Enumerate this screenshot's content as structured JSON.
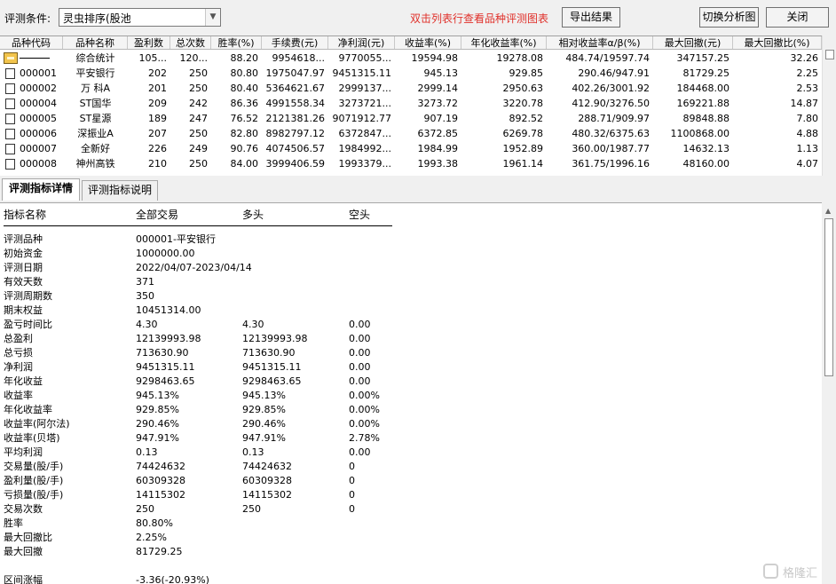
{
  "toolbar": {
    "condition_label": "评测条件:",
    "condition_value": "灵虫排序(股池",
    "hint": "双击列表行查看品种评测图表",
    "export_label": "导出结果",
    "switch_label": "切换分析图",
    "close_label": "关闭"
  },
  "grid": {
    "columns": [
      "品种代码",
      "品种名称",
      "盈利数",
      "总次数",
      "胜率(%)",
      "手续费(元)",
      "净利润(元)",
      "收益率(%)",
      "年化收益率(%)",
      "相对收益率α/β(%)",
      "最大回撤(元)",
      "最大回撤比(%)"
    ],
    "rows": [
      {
        "code": "",
        "name": "综合统计",
        "win": "105...",
        "total": "120...",
        "rate": "88.20",
        "fee": "9954618...",
        "profit": "9770055...",
        "ret": "19594.98",
        "annual": "19278.08",
        "rel": "484.74/19597.74",
        "maxdd": "347157.25",
        "ddratio": "32.26",
        "icon": "folder"
      },
      {
        "code": "000001",
        "name": "平安银行",
        "win": "202",
        "total": "250",
        "rate": "80.80",
        "fee": "1975047.97",
        "profit": "9451315.11",
        "ret": "945.13",
        "annual": "929.85",
        "rel": "290.46/947.91",
        "maxdd": "81729.25",
        "ddratio": "2.25",
        "icon": "doc"
      },
      {
        "code": "000002",
        "name": "万 科A",
        "win": "201",
        "total": "250",
        "rate": "80.40",
        "fee": "5364621.67",
        "profit": "2999137...",
        "ret": "2999.14",
        "annual": "2950.63",
        "rel": "402.26/3001.92",
        "maxdd": "184468.00",
        "ddratio": "2.53",
        "icon": "doc"
      },
      {
        "code": "000004",
        "name": "ST国华",
        "win": "209",
        "total": "242",
        "rate": "86.36",
        "fee": "4991558.34",
        "profit": "3273721...",
        "ret": "3273.72",
        "annual": "3220.78",
        "rel": "412.90/3276.50",
        "maxdd": "169221.88",
        "ddratio": "14.87",
        "icon": "doc"
      },
      {
        "code": "000005",
        "name": "ST星源",
        "win": "189",
        "total": "247",
        "rate": "76.52",
        "fee": "2121381.26",
        "profit": "9071912.77",
        "ret": "907.19",
        "annual": "892.52",
        "rel": "288.71/909.97",
        "maxdd": "89848.88",
        "ddratio": "7.80",
        "icon": "doc"
      },
      {
        "code": "000006",
        "name": "深振业A",
        "win": "207",
        "total": "250",
        "rate": "82.80",
        "fee": "8982797.12",
        "profit": "6372847...",
        "ret": "6372.85",
        "annual": "6269.78",
        "rel": "480.32/6375.63",
        "maxdd": "1100868.00",
        "ddratio": "4.88",
        "icon": "doc"
      },
      {
        "code": "000007",
        "name": "全新好",
        "win": "226",
        "total": "249",
        "rate": "90.76",
        "fee": "4074506.57",
        "profit": "1984992...",
        "ret": "1984.99",
        "annual": "1952.89",
        "rel": "360.00/1987.77",
        "maxdd": "14632.13",
        "ddratio": "1.13",
        "icon": "doc"
      },
      {
        "code": "000008",
        "name": "神州高铁",
        "win": "210",
        "total": "250",
        "rate": "84.00",
        "fee": "3999406.59",
        "profit": "1993379...",
        "ret": "1993.38",
        "annual": "1961.14",
        "rel": "361.75/1996.16",
        "maxdd": "48160.00",
        "ddratio": "4.07",
        "icon": "doc"
      }
    ]
  },
  "tabs": {
    "detail": "评测指标详情",
    "desc": "评测指标说明"
  },
  "detail": {
    "headers": [
      "指标名称",
      "全部交易",
      "多头",
      "空头"
    ],
    "rows": [
      {
        "name": "评测品种",
        "all": "000001-平安银行",
        "long": "",
        "short": ""
      },
      {
        "name": "初始资金",
        "all": "1000000.00",
        "long": "",
        "short": ""
      },
      {
        "name": "评测日期",
        "all": "2022/04/07-2023/04/14",
        "long": "",
        "short": ""
      },
      {
        "name": "有效天数",
        "all": "371",
        "long": "",
        "short": ""
      },
      {
        "name": "评测周期数",
        "all": "350",
        "long": "",
        "short": ""
      },
      {
        "name": "期末权益",
        "all": "10451314.00",
        "long": "",
        "short": ""
      },
      {
        "name": "盈亏时间比",
        "all": "4.30",
        "long": "4.30",
        "short": "0.00"
      },
      {
        "name": "总盈利",
        "all": "12139993.98",
        "long": "12139993.98",
        "short": "0.00"
      },
      {
        "name": "总亏损",
        "all": "713630.90",
        "long": "713630.90",
        "short": "0.00"
      },
      {
        "name": "净利润",
        "all": "9451315.11",
        "long": "9451315.11",
        "short": "0.00"
      },
      {
        "name": "年化收益",
        "all": "9298463.65",
        "long": "9298463.65",
        "short": "0.00"
      },
      {
        "name": "收益率",
        "all": "945.13%",
        "long": "945.13%",
        "short": "0.00%"
      },
      {
        "name": "年化收益率",
        "all": "929.85%",
        "long": "929.85%",
        "short": "0.00%"
      },
      {
        "name": "收益率(阿尔法)",
        "all": "290.46%",
        "long": "290.46%",
        "short": "0.00%"
      },
      {
        "name": "收益率(贝塔)",
        "all": "947.91%",
        "long": "947.91%",
        "short": "2.78%"
      },
      {
        "name": "平均利润",
        "all": "0.13",
        "long": "0.13",
        "short": "0.00"
      },
      {
        "name": "交易量(股/手)",
        "all": "74424632",
        "long": "74424632",
        "short": "0"
      },
      {
        "name": "盈利量(股/手)",
        "all": "60309328",
        "long": "60309328",
        "short": "0"
      },
      {
        "name": "亏损量(股/手)",
        "all": "14115302",
        "long": "14115302",
        "short": "0"
      },
      {
        "name": "交易次数",
        "all": "250",
        "long": "250",
        "short": "0"
      },
      {
        "name": "胜率",
        "all": "80.80%",
        "long": "",
        "short": ""
      },
      {
        "name": "最大回撤比",
        "all": "2.25%",
        "long": "",
        "short": ""
      },
      {
        "name": "最大回撤",
        "all": "81729.25",
        "long": "",
        "short": ""
      },
      {
        "name": "",
        "all": "",
        "long": "",
        "short": ""
      },
      {
        "name": "区间涨幅",
        "all": "-3.36(-20.93%)",
        "long": "",
        "short": ""
      }
    ]
  },
  "watermark": "格隆汇"
}
